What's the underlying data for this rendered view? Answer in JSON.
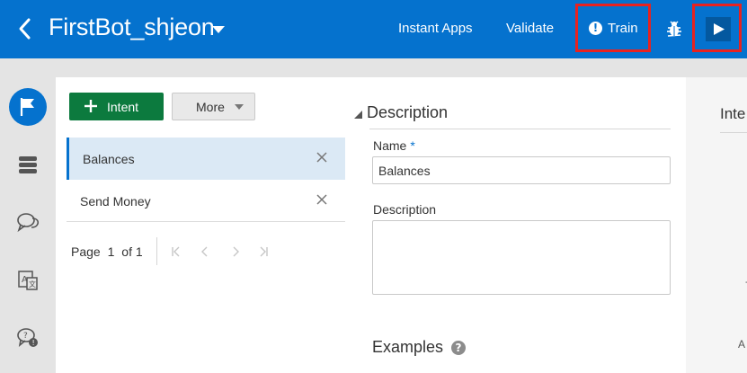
{
  "header": {
    "bot_name": "FirstBot_shjeon",
    "links": {
      "instant_apps": "Instant Apps",
      "validate": "Validate",
      "train": "Train"
    },
    "colors": {
      "bar": "#0572ce",
      "highlight_border": "#e8221f"
    }
  },
  "rail": {
    "items": [
      {
        "icon": "flag-icon",
        "active": true
      },
      {
        "icon": "database-icon",
        "active": false
      },
      {
        "icon": "chat-bubbles-icon",
        "active": false
      },
      {
        "icon": "translate-icon",
        "active": false
      },
      {
        "icon": "question-chat-icon",
        "active": false
      }
    ]
  },
  "left_panel": {
    "add_intent_label": "Intent",
    "more_label": "More",
    "intents": [
      {
        "name": "Balances",
        "selected": true
      },
      {
        "name": "Send Money",
        "selected": false
      }
    ],
    "pager": {
      "page_label": "Page",
      "current": "1",
      "of_label": "of 1"
    }
  },
  "editor": {
    "section_title": "Description",
    "name_label": "Name",
    "required_marker": "*",
    "name_value": "Balances",
    "description_label": "Description",
    "description_value": "",
    "examples_title": "Examples",
    "help_glyph": "?"
  },
  "right_panel": {
    "title_fragment": "Inte",
    "frag1": "-",
    "frag2": "A"
  }
}
